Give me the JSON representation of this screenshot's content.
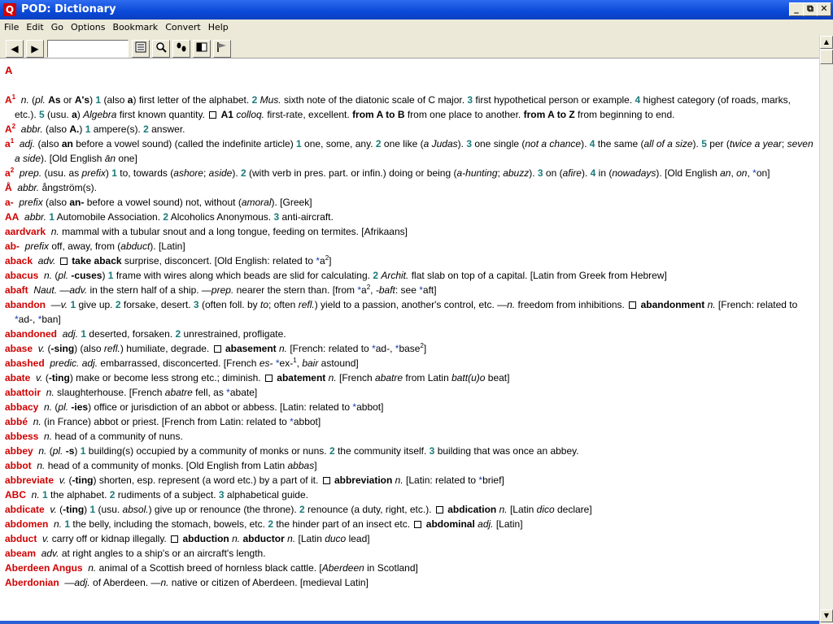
{
  "window": {
    "title": "POD: Dictionary",
    "icon_letter": "Q",
    "controls": {
      "minimize": "_",
      "maximize": "⧉",
      "close": "✕"
    }
  },
  "menu": [
    "File",
    "Edit",
    "Go",
    "Options",
    "Bookmark",
    "Convert",
    "Help"
  ],
  "toolbar": {
    "back": "◀",
    "forward": "▶",
    "search_value": "",
    "buttons": [
      "list-icon",
      "search-icon",
      "footprints-icon",
      "window-icon",
      "flag-icon"
    ]
  },
  "content": {
    "heading": "A",
    "entries": [
      {
        "html": "<span class='hw'>A</span><span class='hw sup'>1</span>&nbsp; <span class='i'>n.</span> (<span class='i'>pl.</span> <span class='b'>As</span> or <span class='b'>A's</span>) <span class='num'>1</span> (also <span class='b'>a</span>) first letter of the alphabet. <span class='num'>2</span> <span class='i'>Mus.</span> sixth note of the diatonic scale of C major. <span class='num'>3</span> first hypothetical person or example. <span class='num'>4</span> highest category (of roads, marks, etc.). <span class='num'>5</span> (usu. <span class='b'>a</span>) <span class='i'>Algebra</span> first known quantity. <span class='bullet'></span> <span class='b'>A1</span> <span class='i'>colloq.</span> first-rate, excellent. <span class='b'>from A to B</span> from one place to another. <span class='b'>from A to Z</span> from beginning to end."
      },
      {
        "html": "<span class='hw'>A</span><span class='hw sup'>2</span>&nbsp; <span class='i'>abbr.</span> (also <span class='b'>A.</span>) <span class='num'>1</span> ampere(s). <span class='num'>2</span> answer."
      },
      {
        "html": "<span class='hw'>a</span><span class='hw sup'>1</span>&nbsp; <span class='i'>adj.</span> (also <span class='b'>an</span> before a vowel sound) (called the indefinite article) <span class='num'>1</span> one, some, any. <span class='num'>2</span> one like (<span class='i'>a Judas</span>). <span class='num'>3</span> one single (<span class='i'>not a chance</span>). <span class='num'>4</span> the same (<span class='i'>all of a size</span>). <span class='num'>5</span> per (<span class='i'>twice a year</span>; <span class='i'>seven a side</span>). [Old English <span class='i'>ān</span> one]"
      },
      {
        "html": "<span class='hw'>a</span><span class='hw sup'>2</span>&nbsp; <span class='i'>prep.</span> (usu. as <span class='i'>prefix</span>) <span class='num'>1</span> to, towards (<span class='i'>ashore</span>; <span class='i'>aside</span>). <span class='num'>2</span> (with verb in pres. part. or infin.) doing or being (<span class='i'>a-hunting</span>; <span class='i'>abuzz</span>). <span class='num'>3</span> on (<span class='i'>afire</span>). <span class='num'>4</span> in (<span class='i'>nowadays</span>). [Old English <span class='i'>an</span>, <span class='i'>on</span>, <span class='arr'>*</span>on]"
      },
      {
        "html": "<span class='hw'>Å</span>&nbsp; <span class='i'>abbr.</span> ångström(s)."
      },
      {
        "html": "<span class='hw'>a-</span>&nbsp; <span class='i'>prefix</span> (also <span class='b'>an-</span> before a vowel sound) not, without (<span class='i'>amoral</span>). [Greek]"
      },
      {
        "html": "<span class='hw'>AA</span>&nbsp; <span class='i'>abbr.</span> <span class='num'>1</span> Automobile Association. <span class='num'>2</span> Alcoholics Anonymous. <span class='num'>3</span> anti-aircraft."
      },
      {
        "html": "<span class='hw'>aardvark</span>&nbsp; <span class='i'>n.</span> mammal with a tubular snout and a long tongue, feeding on termites. [Afrikaans]"
      },
      {
        "html": "<span class='hw'>ab-</span>&nbsp; <span class='i'>prefix</span> off, away, from (<span class='i'>abduct</span>). [Latin]"
      },
      {
        "html": "<span class='hw'>aback</span>&nbsp; <span class='i'>adv.</span> <span class='bullet'></span> <span class='b'>take aback</span> surprise, disconcert. [Old English: related to <span class='arr'>*</span>a<span class='sup'>2</span>]"
      },
      {
        "html": "<span class='hw'>abacus</span>&nbsp; <span class='i'>n.</span> (<span class='i'>pl.</span> <span class='b'>-cuses</span>) <span class='num'>1</span> frame with wires along which beads are slid for calculating. <span class='num'>2</span> <span class='i'>Archit.</span> flat slab on top of a capital. [Latin from Greek from Hebrew]"
      },
      {
        "html": "<span class='hw'>abaft</span>&nbsp; <span class='i'>Naut.</span> —<span class='i'>adv.</span> in the stern half of a ship. —<span class='i'>prep.</span> nearer the stern than. [from <span class='arr'>*</span>a<span class='sup'>2</span>, <span class='i'>-baft</span>: see <span class='arr'>*</span>aft]"
      },
      {
        "html": "<span class='hw'>abandon</span>&nbsp; —<span class='i'>v.</span> <span class='num'>1</span> give up. <span class='num'>2</span> forsake, desert. <span class='num'>3</span> (often foll. by <span class='i'>to</span>; often <span class='i'>refl.</span>) yield to a passion, another's control, etc. —<span class='i'>n.</span> freedom from inhibitions. <span class='bullet'></span> <span class='b'>abandonment</span> <span class='i'>n.</span> [French: related to <span class='arr'>*</span>ad-, <span class='arr'>*</span>ban]"
      },
      {
        "html": "<span class='hw'>abandoned</span>&nbsp; <span class='i'>adj.</span> <span class='num'>1</span> deserted, forsaken. <span class='num'>2</span> unrestrained, profligate."
      },
      {
        "html": "<span class='hw'>abase</span>&nbsp; <span class='i'>v.</span> (<span class='b'>-sing</span>) (also <span class='i'>refl.</span>) humiliate, degrade. <span class='bullet'></span> <span class='b'>abasement</span> <span class='i'>n.</span> [French: related to <span class='arr'>*</span>ad-, <span class='arr'>*</span>base<span class='sup'>2</span>]"
      },
      {
        "html": "<span class='hw'>abashed</span>&nbsp; <span class='i'>predic. adj.</span> embarrassed, disconcerted. [French <span class='i'>es-</span> <span class='arr'>*</span>ex-<span class='sup'>1</span>, <span class='i'>bair</span> astound]"
      },
      {
        "html": "<span class='hw'>abate</span>&nbsp; <span class='i'>v.</span> (<span class='b'>-ting</span>) make or become less strong etc.; diminish. <span class='bullet'></span> <span class='b'>abatement</span> <span class='i'>n.</span> [French <span class='i'>abatre</span> from Latin <span class='i'>batt(u)o</span> beat]"
      },
      {
        "html": "<span class='hw'>abattoir</span>&nbsp; <span class='i'>n.</span> slaughterhouse. [French <span class='i'>abatre</span> fell, as <span class='arr'>*</span>abate]"
      },
      {
        "html": "<span class='hw'>abbacy</span>&nbsp; <span class='i'>n.</span> (<span class='i'>pl.</span> <span class='b'>-ies</span>) office or jurisdiction of an abbot or abbess. [Latin: related to <span class='arr'>*</span>abbot]"
      },
      {
        "html": "<span class='hw'>abbé</span>&nbsp; <span class='i'>n.</span> (in France) abbot or priest. [French from Latin: related to <span class='arr'>*</span>abbot]"
      },
      {
        "html": "<span class='hw'>abbess</span>&nbsp; <span class='i'>n.</span> head of a community of nuns."
      },
      {
        "html": "<span class='hw'>abbey</span>&nbsp; <span class='i'>n.</span> (<span class='i'>pl.</span> <span class='b'>-s</span>) <span class='num'>1</span> building(s) occupied by a community of monks or nuns. <span class='num'>2</span> the community itself. <span class='num'>3</span> building that was once an abbey."
      },
      {
        "html": "<span class='hw'>abbot</span>&nbsp; <span class='i'>n.</span> head of a community of monks. [Old English from Latin <span class='i'>abbas</span>]"
      },
      {
        "html": "<span class='hw'>abbreviate</span>&nbsp; <span class='i'>v.</span> (<span class='b'>-ting</span>) shorten, esp. represent (a word etc.) by a part of it. <span class='bullet'></span> <span class='b'>abbreviation</span> <span class='i'>n.</span> [Latin: related to <span class='arr'>*</span>brief]"
      },
      {
        "html": "<span class='hw'>ABC</span>&nbsp; <span class='i'>n.</span> <span class='num'>1</span> the alphabet. <span class='num'>2</span> rudiments of a subject. <span class='num'>3</span> alphabetical guide."
      },
      {
        "html": "<span class='hw'>abdicate</span>&nbsp; <span class='i'>v.</span> (<span class='b'>-ting</span>) <span class='num'>1</span> (usu. <span class='i'>absol.</span>) give up or renounce (the throne). <span class='num'>2</span> renounce (a duty, right, etc.). <span class='bullet'></span> <span class='b'>abdication</span> <span class='i'>n.</span> [Latin <span class='i'>dico</span> declare]"
      },
      {
        "html": "<span class='hw'>abdomen</span>&nbsp; <span class='i'>n.</span> <span class='num'>1</span> the belly, including the stomach, bowels, etc. <span class='num'>2</span> the hinder part of an insect etc. <span class='bullet'></span> <span class='b'>abdominal</span> <span class='i'>adj.</span> [Latin]"
      },
      {
        "html": "<span class='hw'>abduct</span>&nbsp; <span class='i'>v.</span> carry off or kidnap illegally. <span class='bullet'></span> <span class='b'>abduction</span> <span class='i'>n.</span> <span class='b'>abductor</span> <span class='i'>n.</span> [Latin <span class='i'>duco</span> lead]"
      },
      {
        "html": "<span class='hw'>abeam</span>&nbsp; <span class='i'>adv.</span> at right angles to a ship's or an aircraft's length."
      },
      {
        "html": "<span class='hw'>Aberdeen Angus</span>&nbsp; <span class='i'>n.</span> animal of a Scottish breed of hornless black cattle. [<span class='i'>Aberdeen</span> in Scotland]"
      },
      {
        "html": "<span class='hw'>Aberdonian</span>&nbsp; —<span class='i'>adj.</span> of Aberdeen. —<span class='i'>n.</span> native or citizen of Aberdeen. [medieval Latin]"
      }
    ]
  }
}
